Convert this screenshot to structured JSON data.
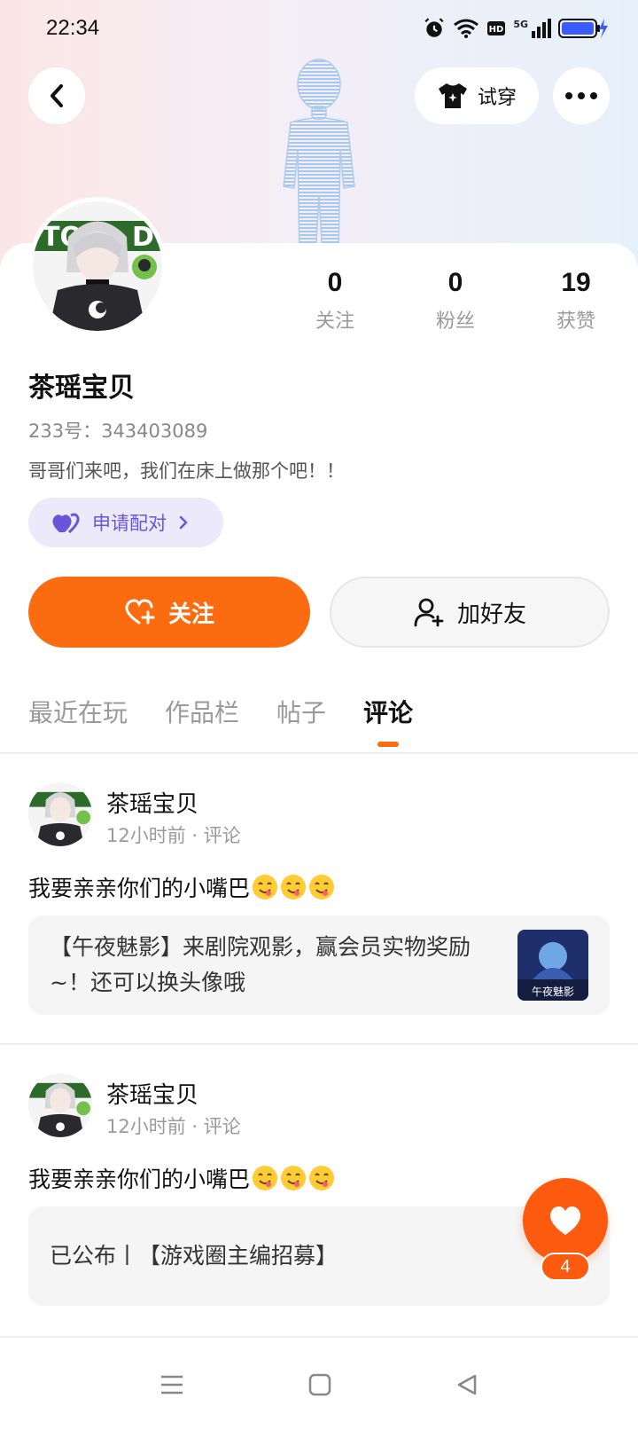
{
  "status_bar": {
    "time": "22:34",
    "network": "5G"
  },
  "header": {
    "tryon_label": "试穿"
  },
  "profile": {
    "nickname": "茶瑶宝贝",
    "uid": "233号：343403089",
    "bio": "哥哥们来吧，我们在床上做那个吧！！",
    "pair_label": "申请配对",
    "stats": [
      {
        "value": "0",
        "label": "关注"
      },
      {
        "value": "0",
        "label": "粉丝"
      },
      {
        "value": "19",
        "label": "获赞"
      }
    ],
    "follow_label": "关注",
    "add_friend_label": "加好友"
  },
  "tabs": [
    {
      "label": "最近在玩",
      "active": false
    },
    {
      "label": "作品栏",
      "active": false
    },
    {
      "label": "帖子",
      "active": false
    },
    {
      "label": "评论",
      "active": true
    }
  ],
  "comments": [
    {
      "name": "茶瑶宝贝",
      "meta": "12小时前 · 评论",
      "text": "我要亲亲你们的小嘴巴",
      "quote": "【午夜魅影】来剧院观影，赢会员实物奖励~！还可以换头像哦",
      "thumb_caption": "午夜魅影"
    },
    {
      "name": "茶瑶宝贝",
      "meta": "12小时前 · 评论",
      "text": "我要亲亲你们的小嘴巴",
      "quote": "已公布丨【游戏圈主编招募】"
    }
  ],
  "like_fab": {
    "count": "4"
  },
  "colors": {
    "accent": "#fb6c10",
    "pair": "#6a55d8"
  }
}
